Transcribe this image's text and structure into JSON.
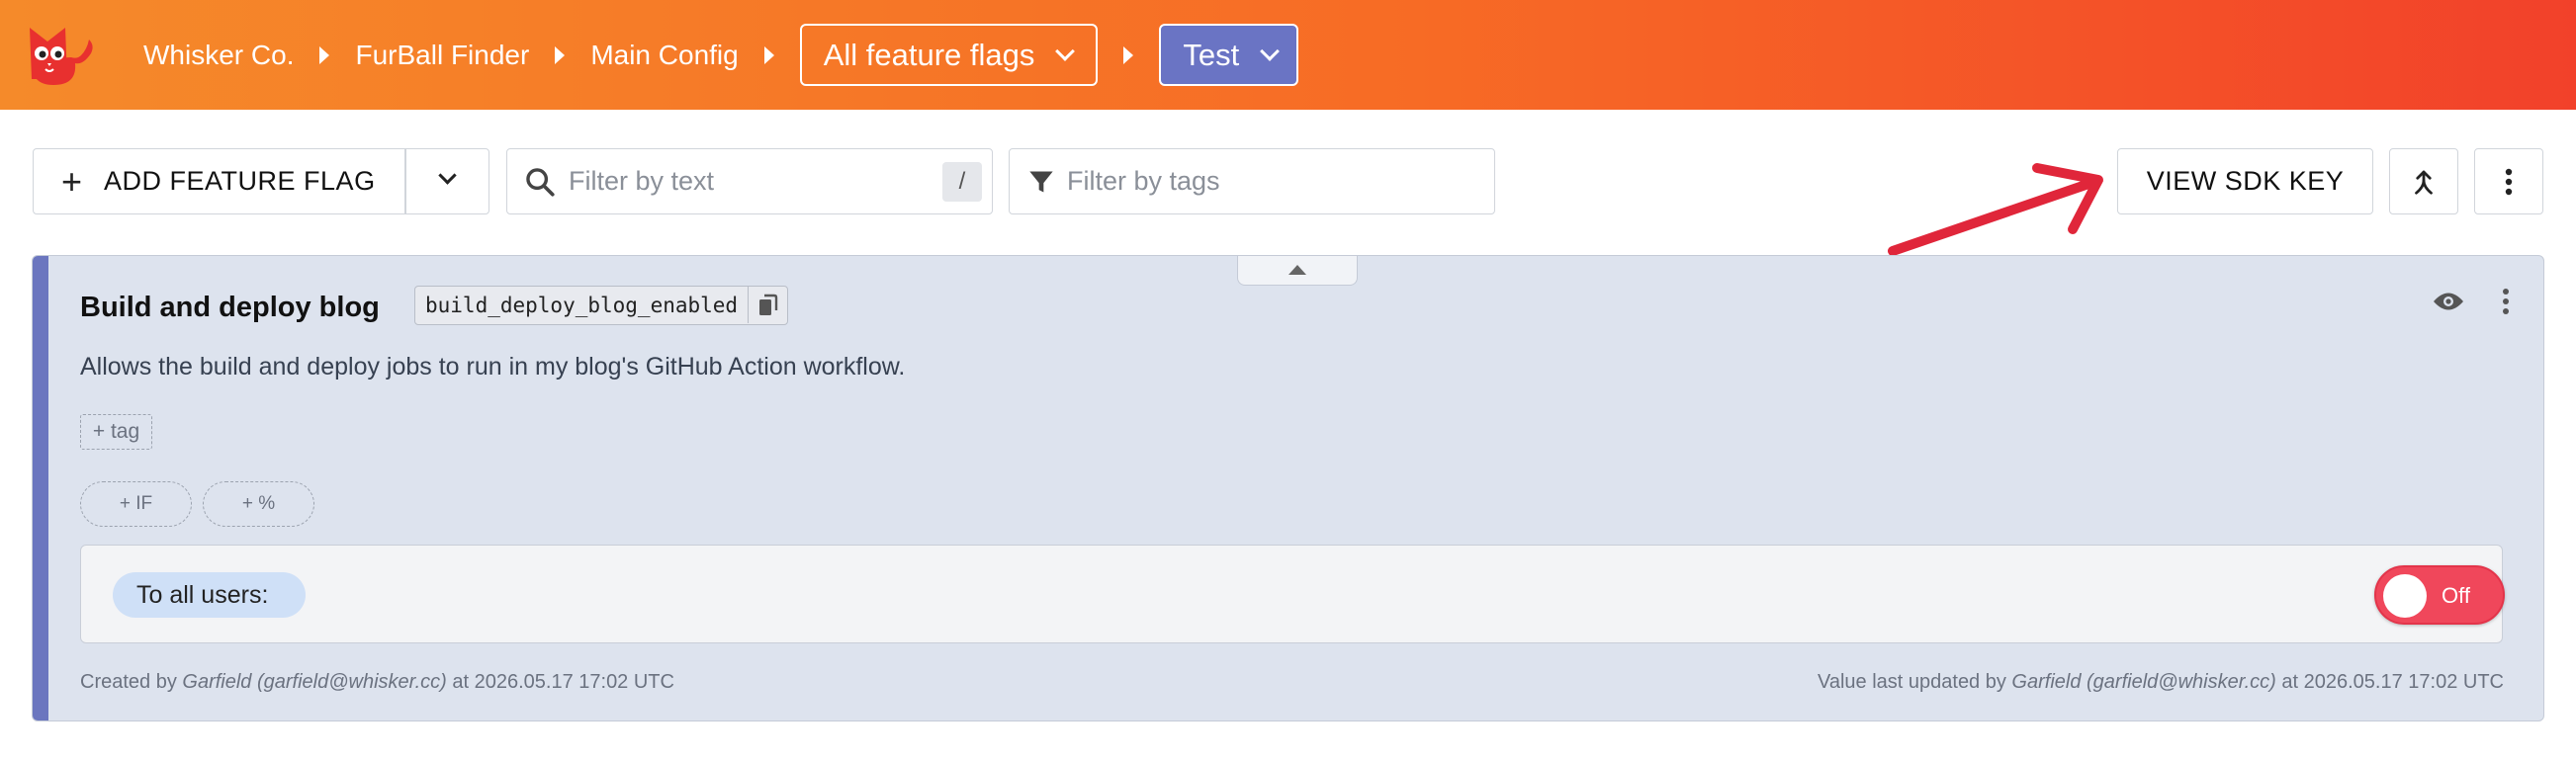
{
  "header": {
    "breadcrumbs": [
      "Whisker Co.",
      "FurBall Finder",
      "Main Config"
    ],
    "view_dropdown": "All feature flags",
    "env_dropdown": "Test"
  },
  "toolbar": {
    "add_label": "ADD FEATURE FLAG",
    "filter_text_placeholder": "Filter by text",
    "filter_text_shortcut": "/",
    "filter_tags_placeholder": "Filter by tags",
    "sdk_key_label": "VIEW SDK KEY"
  },
  "flag": {
    "name": "Build and deploy blog",
    "key": "build_deploy_blog_enabled",
    "description": "Allows the build and deploy jobs to run in my blog's GitHub Action workflow.",
    "tag_add_label": "+ tag",
    "if_add_label": "+ IF",
    "percent_add_label": "+ %",
    "rule_label": "To all users:",
    "toggle_label": "Off",
    "toggle_on": false,
    "created_prefix": "Created by ",
    "created_user": "Garfield (garfield@whisker.cc)",
    "created_suffix": " at 2026.05.17 17:02 UTC",
    "updated_prefix": "Value last updated by ",
    "updated_user": "Garfield (garfield@whisker.cc)",
    "updated_suffix": " at 2026.05.17 17:02 UTC"
  },
  "colors": {
    "header_start": "#f58a2a",
    "header_end": "#f2412a",
    "env_badge": "#6a74c4",
    "card_stripe": "#6b76bf",
    "toggle_off": "#f0475b",
    "annotation_arrow": "#e0263a"
  }
}
